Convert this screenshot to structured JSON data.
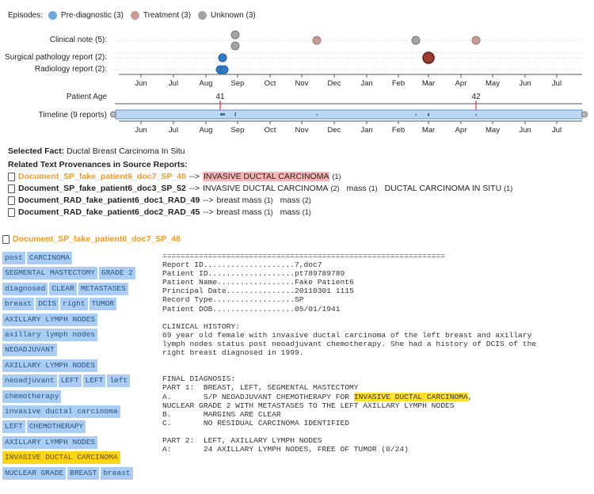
{
  "legend": {
    "title": "Episodes:",
    "items": [
      {
        "label": "Pre-diagnostic (3)",
        "color": "#6ea8dc"
      },
      {
        "label": "Treatment (3)",
        "color": "#c89a93"
      },
      {
        "label": "Unknown (3)",
        "color": "#a4a4a4"
      }
    ]
  },
  "rows": {
    "clinical": "Clinical note (5):",
    "surgical": "Surgical pathology report (2):",
    "radiology": "Radiology report (2):",
    "age": "Patient Age",
    "timeline": "Timeline (9 reports)"
  },
  "months": [
    "Jun",
    "Jul",
    "Aug",
    "Sep",
    "Oct",
    "Nov",
    "Dec",
    "Jan",
    "Feb",
    "Mar",
    "Apr",
    "May",
    "Jun",
    "Jul"
  ],
  "ages": [
    "41",
    "42"
  ],
  "fact": {
    "label": "Selected Fact:",
    "value": "Ductal Breast Carcinoma In Situ"
  },
  "provenance_title": "Related Text Provenances in Source Reports:",
  "provenances": [
    {
      "doc": "Document_SP_fake_patient6_doc7_SP_48",
      "arrow": "-->",
      "active": true,
      "terms": [
        {
          "text": "INVASIVE DUCTAL CARCINOMA",
          "count": "(1)",
          "hl": true
        }
      ]
    },
    {
      "doc": "Document_SP_fake_patient6_doc3_SP_52",
      "arrow": "-->",
      "active": false,
      "terms": [
        {
          "text": "INVASIVE DUCTAL CARCINOMA",
          "count": "(2)"
        },
        {
          "text": "mass",
          "count": "(1)"
        },
        {
          "text": "DUCTAL CARCINOMA IN SITU",
          "count": "(1)"
        }
      ]
    },
    {
      "doc": "Document_RAD_fake_patient6_doc1_RAD_49",
      "arrow": "-->",
      "active": false,
      "terms": [
        {
          "text": "breast mass",
          "count": "(1)"
        },
        {
          "text": "mass",
          "count": "(2)"
        }
      ]
    },
    {
      "doc": "Document_RAD_fake_patient6_doc2_RAD_45",
      "arrow": "-->",
      "active": false,
      "terms": [
        {
          "text": "breast mass",
          "count": "(1)"
        },
        {
          "text": "mass",
          "count": "(1)"
        }
      ]
    }
  ],
  "current_doc": "Document_SP_fake_patient6_doc7_SP_48",
  "tags": [
    [
      "post",
      "CARCINOMA"
    ],
    [
      "SEGMENTAL MASTECTOMY",
      "GRADE 2"
    ],
    [
      "diagnosed",
      "CLEAR",
      "METASTASES"
    ],
    [
      "breast",
      "DCIS",
      "right",
      "TUMOR"
    ],
    [
      "AXILLARY LYMPH NODES"
    ],
    [
      "axillary lymph nodes"
    ],
    [
      "NEOADJUVANT"
    ],
    [
      "AXILLARY LYMPH NODES"
    ],
    [
      "neoadjuvant",
      "LEFT",
      "LEFT",
      "left"
    ],
    [
      "chemotherapy"
    ],
    [
      "invasive ductal carcinoma"
    ],
    [
      "LEFT",
      "CHEMOTHERAPY"
    ],
    [
      "AXILLARY LYMPH NODES"
    ],
    [
      "INVASIVE DUCTAL CARCINOMA"
    ],
    [
      "NUCLEAR GRADE",
      "BREAST",
      "breast"
    ]
  ],
  "report": {
    "rule": "==============================================================",
    "header": [
      "Report ID....................7,doc7",
      "Patient ID...................pt789789789",
      "Patient Name.................Fake Patient6",
      "Principal Date...............20110301 1115",
      "Record Type..................SP",
      "Patient DOB..................05/01/1941"
    ],
    "clinical_history": [
      "CLINICAL HISTORY:",
      "69 year old female with invasive ductal carcinoma of the left breast and axillary",
      "lymph nodes status post neoadjuvant chemotherapy. She had a history of DCIS of the",
      "right breast diagnosed in 1999."
    ],
    "final_diagnosis_title": "FINAL DIAGNOSIS:",
    "part1": "PART 1:  BREAST, LEFT, SEGMENTAL MASTECTOMY",
    "a_prefix": "A.       S/P NEOADJUVANT CHEMOTHERAPY FOR ",
    "a_hl": "INVASIVE DUCTAL CARCINOMA",
    "a_suffix": ",",
    "a_line2": "NUCLEAR GRADE 2 WITH METASTASES TO THE LEFT AXILLARY LYMPH NODES",
    "b_line": "B.       MARGINS ARE CLEAR",
    "c_line": "C.       NO RESIDUAL CARCINOMA IDENTIFIED",
    "part2": "PART 2:  LEFT, AXILLARY LYMPH NODES",
    "part2_a": "A:       24 AXILLARY LYMPH NODES, FREE OF TUMOR (0/24)"
  }
}
